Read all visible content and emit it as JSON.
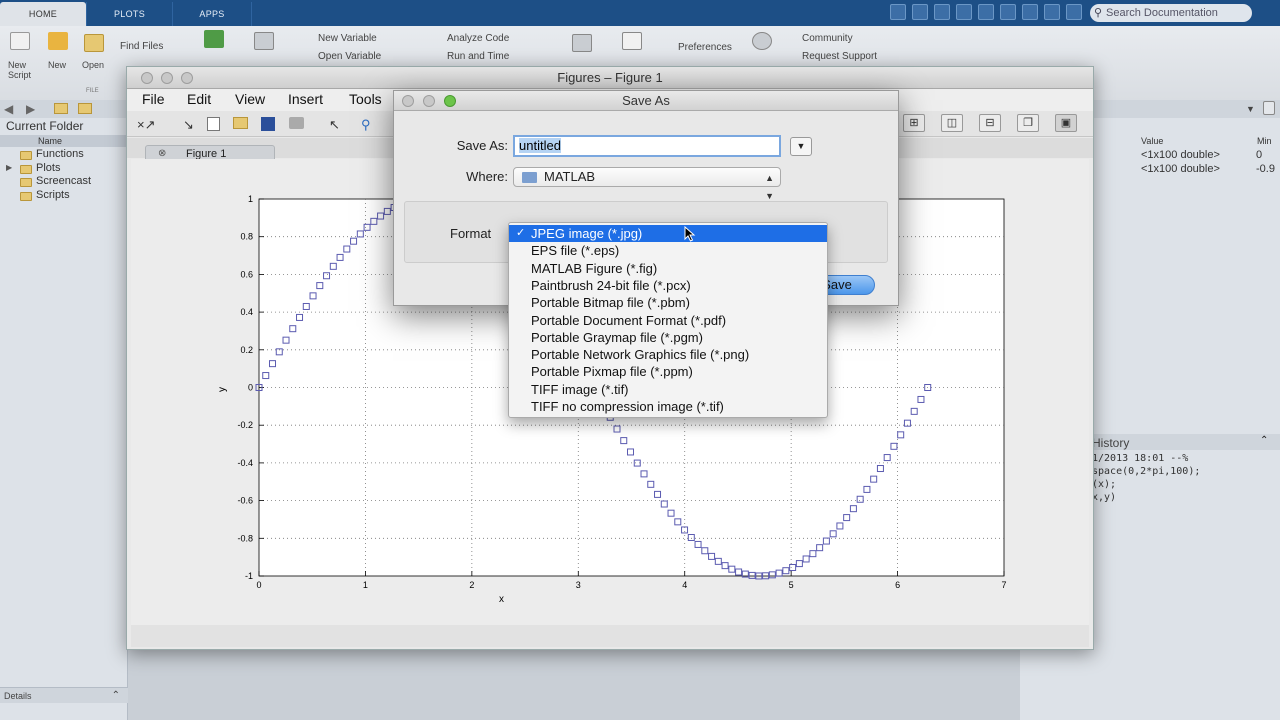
{
  "desktop": {
    "tabs": [
      {
        "label": "HOME"
      },
      {
        "label": "PLOTS"
      },
      {
        "label": "APPS"
      }
    ],
    "search_label": "Search Documentation",
    "ribbon": {
      "new_script": "New\nScript",
      "new": "New",
      "open": "Open",
      "find_files": "Find Files",
      "new_variable": "New Variable",
      "open_variable": "Open Variable",
      "analyze_code": "Analyze Code",
      "run_and_time": "Run and Time",
      "preferences": "Preferences",
      "community": "Community",
      "request_support": "Request Support",
      "file_group": "FILE"
    },
    "current_folder": {
      "title": "Current Folder",
      "column": "Name",
      "items": [
        {
          "label": "Functions"
        },
        {
          "label": "Plots"
        },
        {
          "label": "Screencast"
        },
        {
          "label": "Scripts"
        }
      ],
      "details": "Details"
    },
    "workspace": {
      "col_value": "Value",
      "col_min": "Min",
      "rows": [
        {
          "value": "<1x100 double>",
          "min": "0"
        },
        {
          "value": "<1x100 double>",
          "min": "-0.9"
        }
      ]
    },
    "history": {
      "title": "History",
      "lines": [
        "1/2013 18:01 --%",
        "space(0,2*pi,100);",
        "(x);",
        "x,y)"
      ]
    }
  },
  "figure": {
    "title": "Figures – Figure 1",
    "menu": [
      "File",
      "Edit",
      "View",
      "Insert",
      "Tools"
    ],
    "tab_label": "Figure 1"
  },
  "dialog": {
    "title": "Save As",
    "saveas_label": "Save As:",
    "filename": "untitled",
    "where_label": "Where:",
    "where_value": "MATLAB",
    "format_label": "Format",
    "save_button": "Save",
    "format_options": [
      {
        "label": "JPEG image (*.jpg)",
        "selected": true
      },
      {
        "label": "EPS file (*.eps)"
      },
      {
        "label": "MATLAB Figure (*.fig)"
      },
      {
        "label": "Paintbrush 24-bit file (*.pcx)"
      },
      {
        "label": "Portable Bitmap file (*.pbm)"
      },
      {
        "label": "Portable Document Format (*.pdf)"
      },
      {
        "label": "Portable Graymap file (*.pgm)"
      },
      {
        "label": "Portable Network Graphics file (*.png)"
      },
      {
        "label": "Portable Pixmap file (*.ppm)"
      },
      {
        "label": "TIFF image (*.tif)"
      },
      {
        "label": "TIFF no compression image (*.tif)"
      }
    ]
  },
  "chart_data": {
    "type": "scatter",
    "marker": "square",
    "marker_color": "#5b5bb0",
    "x_function": "linspace(0,2*pi,100)",
    "y_function": "sin(x)",
    "n_points": 100,
    "xlim": [
      0,
      7
    ],
    "ylim": [
      -1,
      1
    ],
    "xticks": [
      "0",
      "1",
      "2",
      "3",
      "4",
      "5",
      "6",
      "7"
    ],
    "yticks": [
      "-1",
      "-0.8",
      "-0.6",
      "-0.4",
      "-0.2",
      "0",
      "0.2",
      "0.4",
      "0.6",
      "0.8",
      "1"
    ],
    "xlabel": "x",
    "ylabel": "y",
    "grid": true
  }
}
